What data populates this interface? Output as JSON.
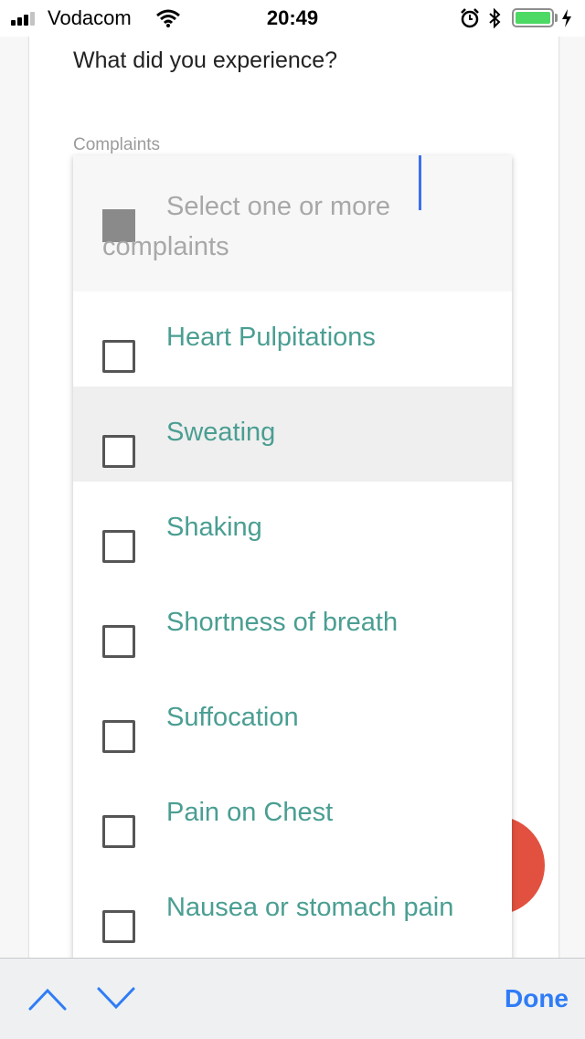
{
  "status_bar": {
    "carrier": "Vodacom",
    "time": "20:49",
    "battery_level": 1.0,
    "icons": [
      "signal-icon",
      "wifi-icon",
      "alarm-icon",
      "bluetooth-icon",
      "battery-icon",
      "charging-icon"
    ]
  },
  "form": {
    "question": "What did you experience?",
    "field_label": "Complaints"
  },
  "dropdown": {
    "select_all_label": "Select one or more complaints",
    "options": [
      {
        "label": "Heart Pulpitations",
        "checked": false
      },
      {
        "label": "Sweating",
        "checked": false
      },
      {
        "label": "Shaking",
        "checked": false
      },
      {
        "label": "Shortness of breath",
        "checked": false
      },
      {
        "label": "Suffocation",
        "checked": false
      },
      {
        "label": "Pain on Chest",
        "checked": false
      },
      {
        "label": "Nausea or stomach pain",
        "checked": false
      }
    ]
  },
  "accessory_bar": {
    "done_label": "Done",
    "icons": [
      "chevron-up-icon",
      "chevron-down-icon"
    ]
  },
  "colors": {
    "option_text": "#4a9e92",
    "fab": "#e25140",
    "done": "#2f7cf6",
    "caret": "#3b6ff0"
  }
}
